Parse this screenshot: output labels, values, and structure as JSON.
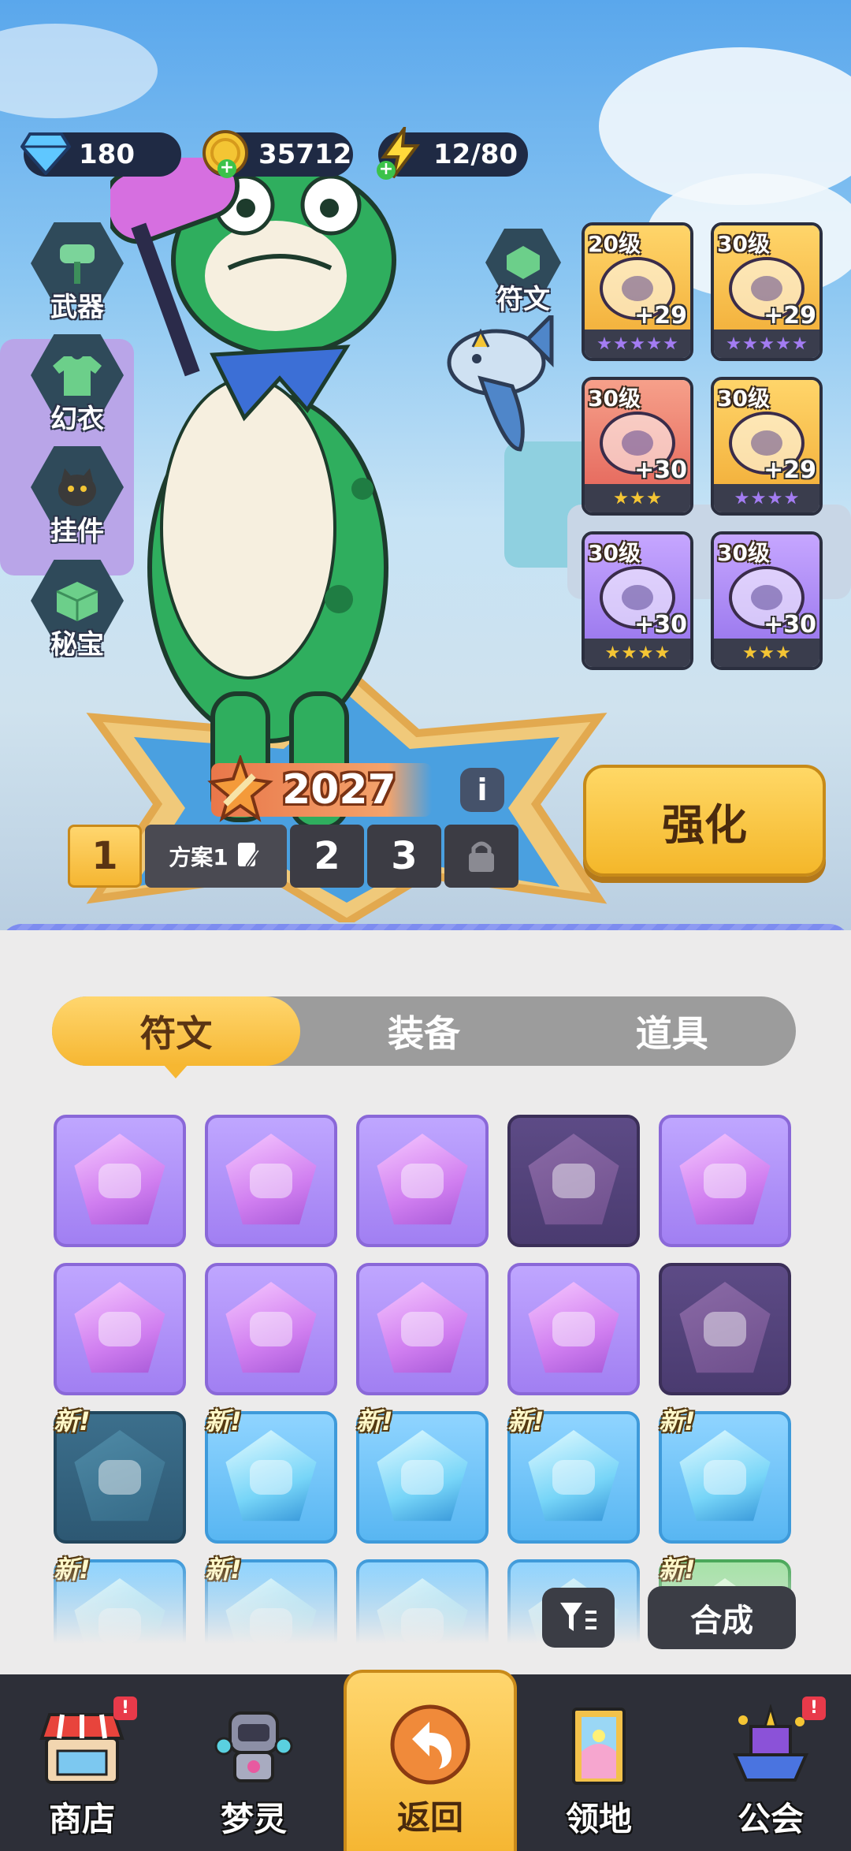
{
  "currencies": {
    "gems": "180",
    "gold": "35712",
    "energy": "12/80"
  },
  "side_menu": {
    "weapon": "武器",
    "costume": "幻衣",
    "pendant": "挂件",
    "treasure": "秘宝",
    "rune": "符文"
  },
  "equipment": [
    {
      "level": "20级",
      "plus": "+29",
      "stars": 5,
      "frame": "gold",
      "star_color": "#a37cf2"
    },
    {
      "level": "30级",
      "plus": "+29",
      "stars": 5,
      "frame": "gold",
      "star_color": "#a37cf2"
    },
    {
      "level": "30级",
      "plus": "+30",
      "stars": 3,
      "frame": "red",
      "star_color": "#f4c534"
    },
    {
      "level": "30级",
      "plus": "+29",
      "stars": 4,
      "frame": "gold",
      "star_color": "#a37cf2"
    },
    {
      "level": "30级",
      "plus": "+30",
      "stars": 4,
      "frame": "purple",
      "star_color": "#f4c534"
    },
    {
      "level": "30级",
      "plus": "+30",
      "stars": 3,
      "frame": "purple",
      "star_color": "#f4c534"
    }
  ],
  "power": "2027",
  "plans": {
    "active": "1",
    "active_name": "方案1",
    "others": [
      "2",
      "3"
    ]
  },
  "enhance_label": "强化",
  "tabs": [
    {
      "label": "符文",
      "active": true
    },
    {
      "label": "装备",
      "active": false
    },
    {
      "label": "道具",
      "active": false
    }
  ],
  "inventory": [
    {
      "color": "purple",
      "dim": false,
      "new": false
    },
    {
      "color": "purple",
      "dim": false,
      "new": false
    },
    {
      "color": "purple",
      "dim": false,
      "new": false
    },
    {
      "color": "purple",
      "dim": true,
      "new": false
    },
    {
      "color": "purple",
      "dim": false,
      "new": false
    },
    {
      "color": "purple",
      "dim": false,
      "new": false
    },
    {
      "color": "purple",
      "dim": false,
      "new": false
    },
    {
      "color": "purple",
      "dim": false,
      "new": false
    },
    {
      "color": "purple",
      "dim": false,
      "new": false
    },
    {
      "color": "purple",
      "dim": true,
      "new": false
    },
    {
      "color": "blue",
      "dim": true,
      "new": true
    },
    {
      "color": "blue",
      "dim": false,
      "new": true
    },
    {
      "color": "blue",
      "dim": false,
      "new": true
    },
    {
      "color": "blue",
      "dim": false,
      "new": true
    },
    {
      "color": "blue",
      "dim": false,
      "new": true
    },
    {
      "color": "blue",
      "dim": false,
      "new": true
    },
    {
      "color": "blue",
      "dim": false,
      "new": true
    },
    {
      "color": "blue",
      "dim": false,
      "new": false
    },
    {
      "color": "blue",
      "dim": false,
      "new": false
    },
    {
      "color": "green",
      "dim": false,
      "new": true
    }
  ],
  "new_tag": "新!",
  "combine_label": "合成",
  "nav": {
    "shop": "商店",
    "spirit": "梦灵",
    "back": "返回",
    "territory": "领地",
    "guild": "公会",
    "badge": "!"
  },
  "colors": {
    "accent_gold": "#f6b732",
    "purple_gem": "#a17ff2",
    "blue_gem": "#58b6f2",
    "dark_ui": "#2d2f38"
  }
}
